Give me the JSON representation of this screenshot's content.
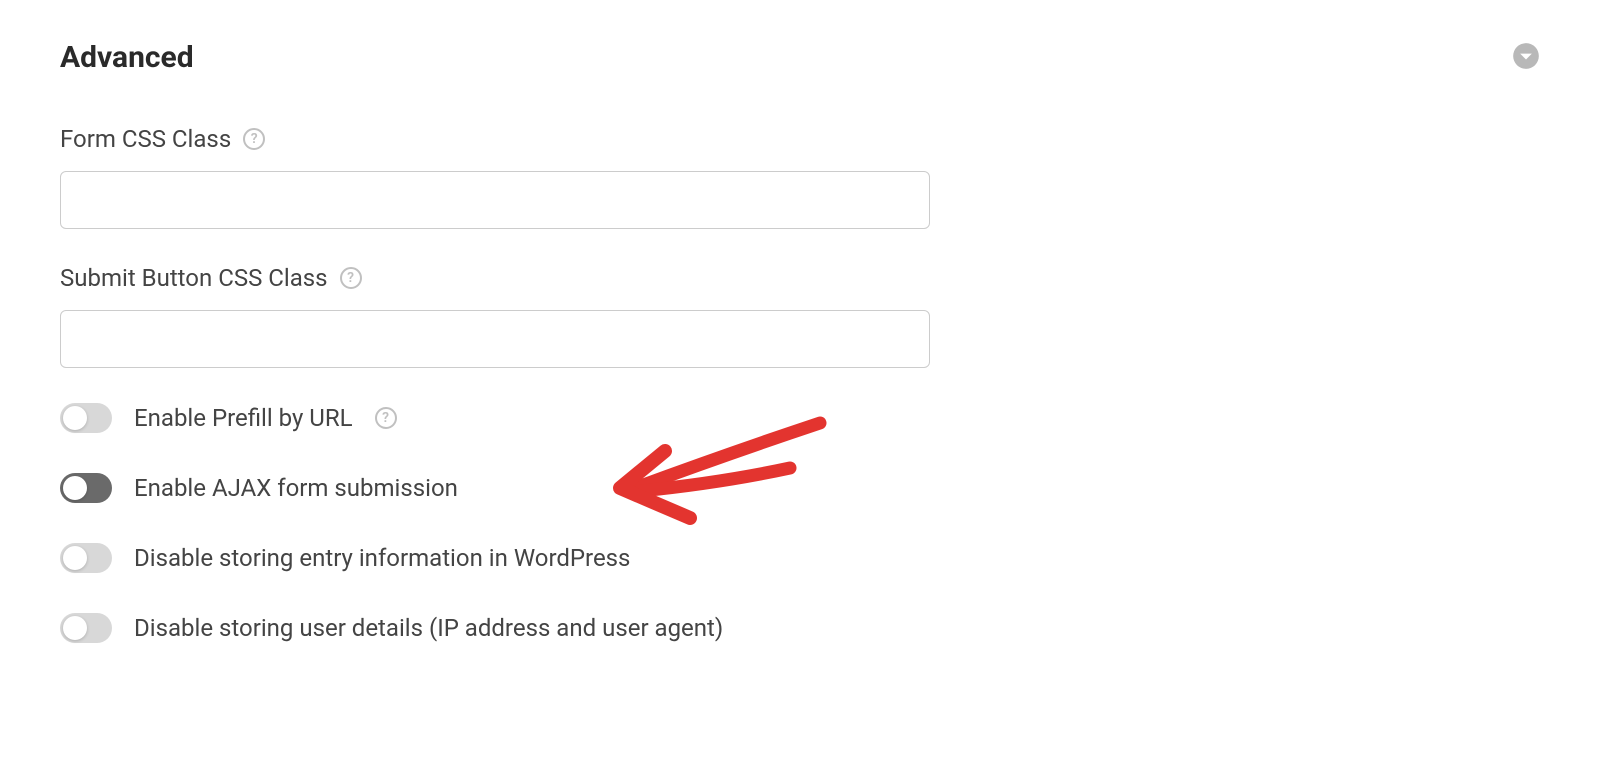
{
  "section": {
    "title": "Advanced"
  },
  "fields": {
    "formCssClass": {
      "label": "Form CSS Class",
      "value": ""
    },
    "submitButtonCssClass": {
      "label": "Submit Button CSS Class",
      "value": ""
    }
  },
  "toggles": {
    "prefillByUrl": {
      "label": "Enable Prefill by URL"
    },
    "ajaxSubmission": {
      "label": "Enable AJAX form submission"
    },
    "disableStoringEntry": {
      "label": "Disable storing entry information in WordPress"
    },
    "disableStoringUser": {
      "label": "Disable storing user details (IP address and user agent)"
    }
  }
}
